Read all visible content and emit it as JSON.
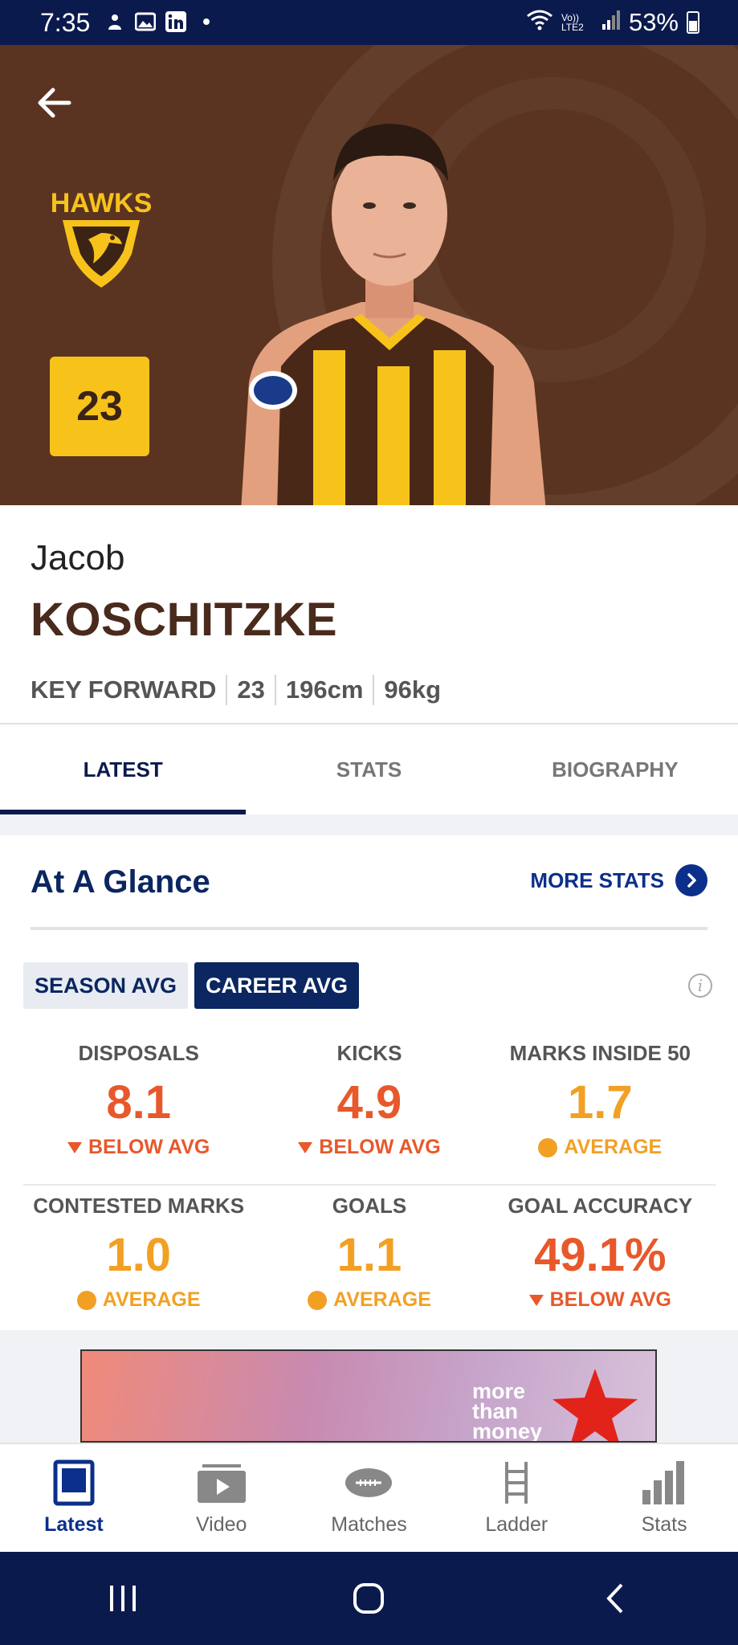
{
  "status_bar": {
    "time": "7:35",
    "battery": "53%",
    "network": "Vo)) LTE2"
  },
  "player": {
    "first_name": "Jacob",
    "last_name": "KOSCHITZKE",
    "number": "23",
    "position": "KEY FORWARD",
    "games": "23",
    "height": "196cm",
    "weight": "96kg",
    "club": "HAWKS"
  },
  "tabs": [
    {
      "label": "LATEST",
      "active": true
    },
    {
      "label": "STATS",
      "active": false
    },
    {
      "label": "BIOGRAPHY",
      "active": false
    }
  ],
  "glance": {
    "title": "At A Glance",
    "more_stats": "MORE STATS",
    "toggle_season": "SEASON AVG",
    "toggle_career": "CAREER AVG",
    "selected": "CAREER AVG"
  },
  "stats": [
    {
      "label": "DISPOSALS",
      "value": "8.1",
      "trend": "BELOW AVG",
      "status": "below"
    },
    {
      "label": "KICKS",
      "value": "4.9",
      "trend": "BELOW AVG",
      "status": "below"
    },
    {
      "label": "MARKS INSIDE 50",
      "value": "1.7",
      "trend": "AVERAGE",
      "status": "average"
    },
    {
      "label": "CONTESTED MARKS",
      "value": "1.0",
      "trend": "AVERAGE",
      "status": "average"
    },
    {
      "label": "GOALS",
      "value": "1.1",
      "trend": "AVERAGE",
      "status": "average"
    },
    {
      "label": "GOAL ACCURACY",
      "value": "49.1%",
      "trend": "BELOW AVG",
      "status": "below"
    }
  ],
  "ad": {
    "text": "more\nthan\nmoney"
  },
  "bottom_nav": [
    {
      "label": "Latest",
      "icon": "latest-icon",
      "active": true
    },
    {
      "label": "Video",
      "icon": "video-icon",
      "active": false
    },
    {
      "label": "Matches",
      "icon": "football-icon",
      "active": false
    },
    {
      "label": "Ladder",
      "icon": "ladder-icon",
      "active": false
    },
    {
      "label": "Stats",
      "icon": "bar-chart-icon",
      "active": false
    }
  ],
  "colors": {
    "navy": "#0b1a4d",
    "brown": "#5a3420",
    "gold": "#f7c31b",
    "below": "#e8582a",
    "average": "#f2a024"
  }
}
